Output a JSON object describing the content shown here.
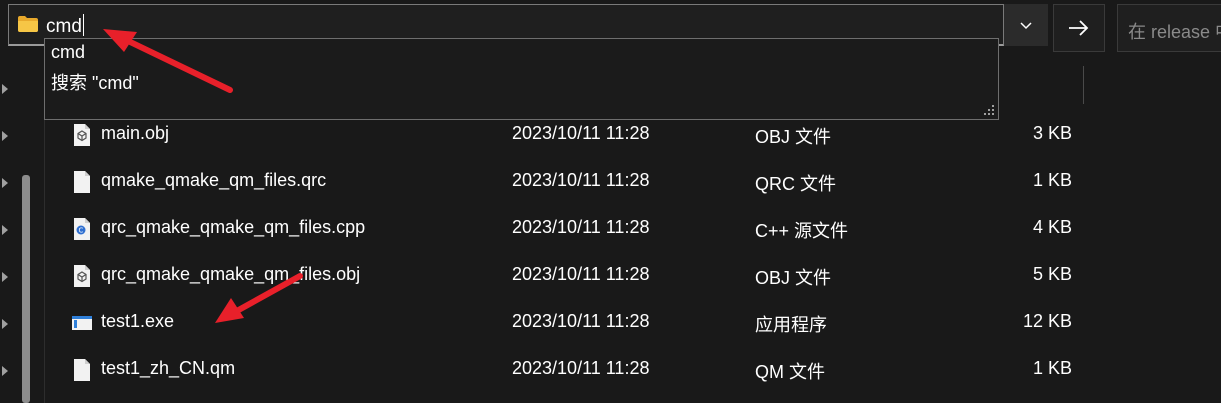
{
  "address_bar": {
    "value": "cmd",
    "icon": "folder-icon"
  },
  "toolbar": {
    "dropdown_icon": "chevron-down-icon",
    "go_icon": "arrow-right-icon"
  },
  "search": {
    "placeholder": "在 release 中"
  },
  "autocomplete": {
    "items": [
      "cmd",
      "搜索 \"cmd\""
    ]
  },
  "files": [
    {
      "name": "main.obj",
      "date": "2023/10/11 11:28",
      "type": "OBJ 文件",
      "size": "3 KB",
      "icon": "obj-file-icon"
    },
    {
      "name": "qmake_qmake_qm_files.qrc",
      "date": "2023/10/11 11:28",
      "type": "QRC 文件",
      "size": "1 KB",
      "icon": "text-file-icon"
    },
    {
      "name": "qrc_qmake_qmake_qm_files.cpp",
      "date": "2023/10/11 11:28",
      "type": "C++ 源文件",
      "size": "4 KB",
      "icon": "cpp-file-icon"
    },
    {
      "name": "qrc_qmake_qmake_qm_files.obj",
      "date": "2023/10/11 11:28",
      "type": "OBJ 文件",
      "size": "5 KB",
      "icon": "obj-file-icon"
    },
    {
      "name": "test1.exe",
      "date": "2023/10/11 11:28",
      "type": "应用程序",
      "size": "12 KB",
      "icon": "exe-file-icon"
    },
    {
      "name": "test1_zh_CN.qm",
      "date": "2023/10/11 11:28",
      "type": "QM 文件",
      "size": "1 KB",
      "icon": "text-file-icon"
    }
  ],
  "colors": {
    "background": "#191919",
    "annotation_arrow": "#e8202a",
    "folder": "#f6c646"
  }
}
